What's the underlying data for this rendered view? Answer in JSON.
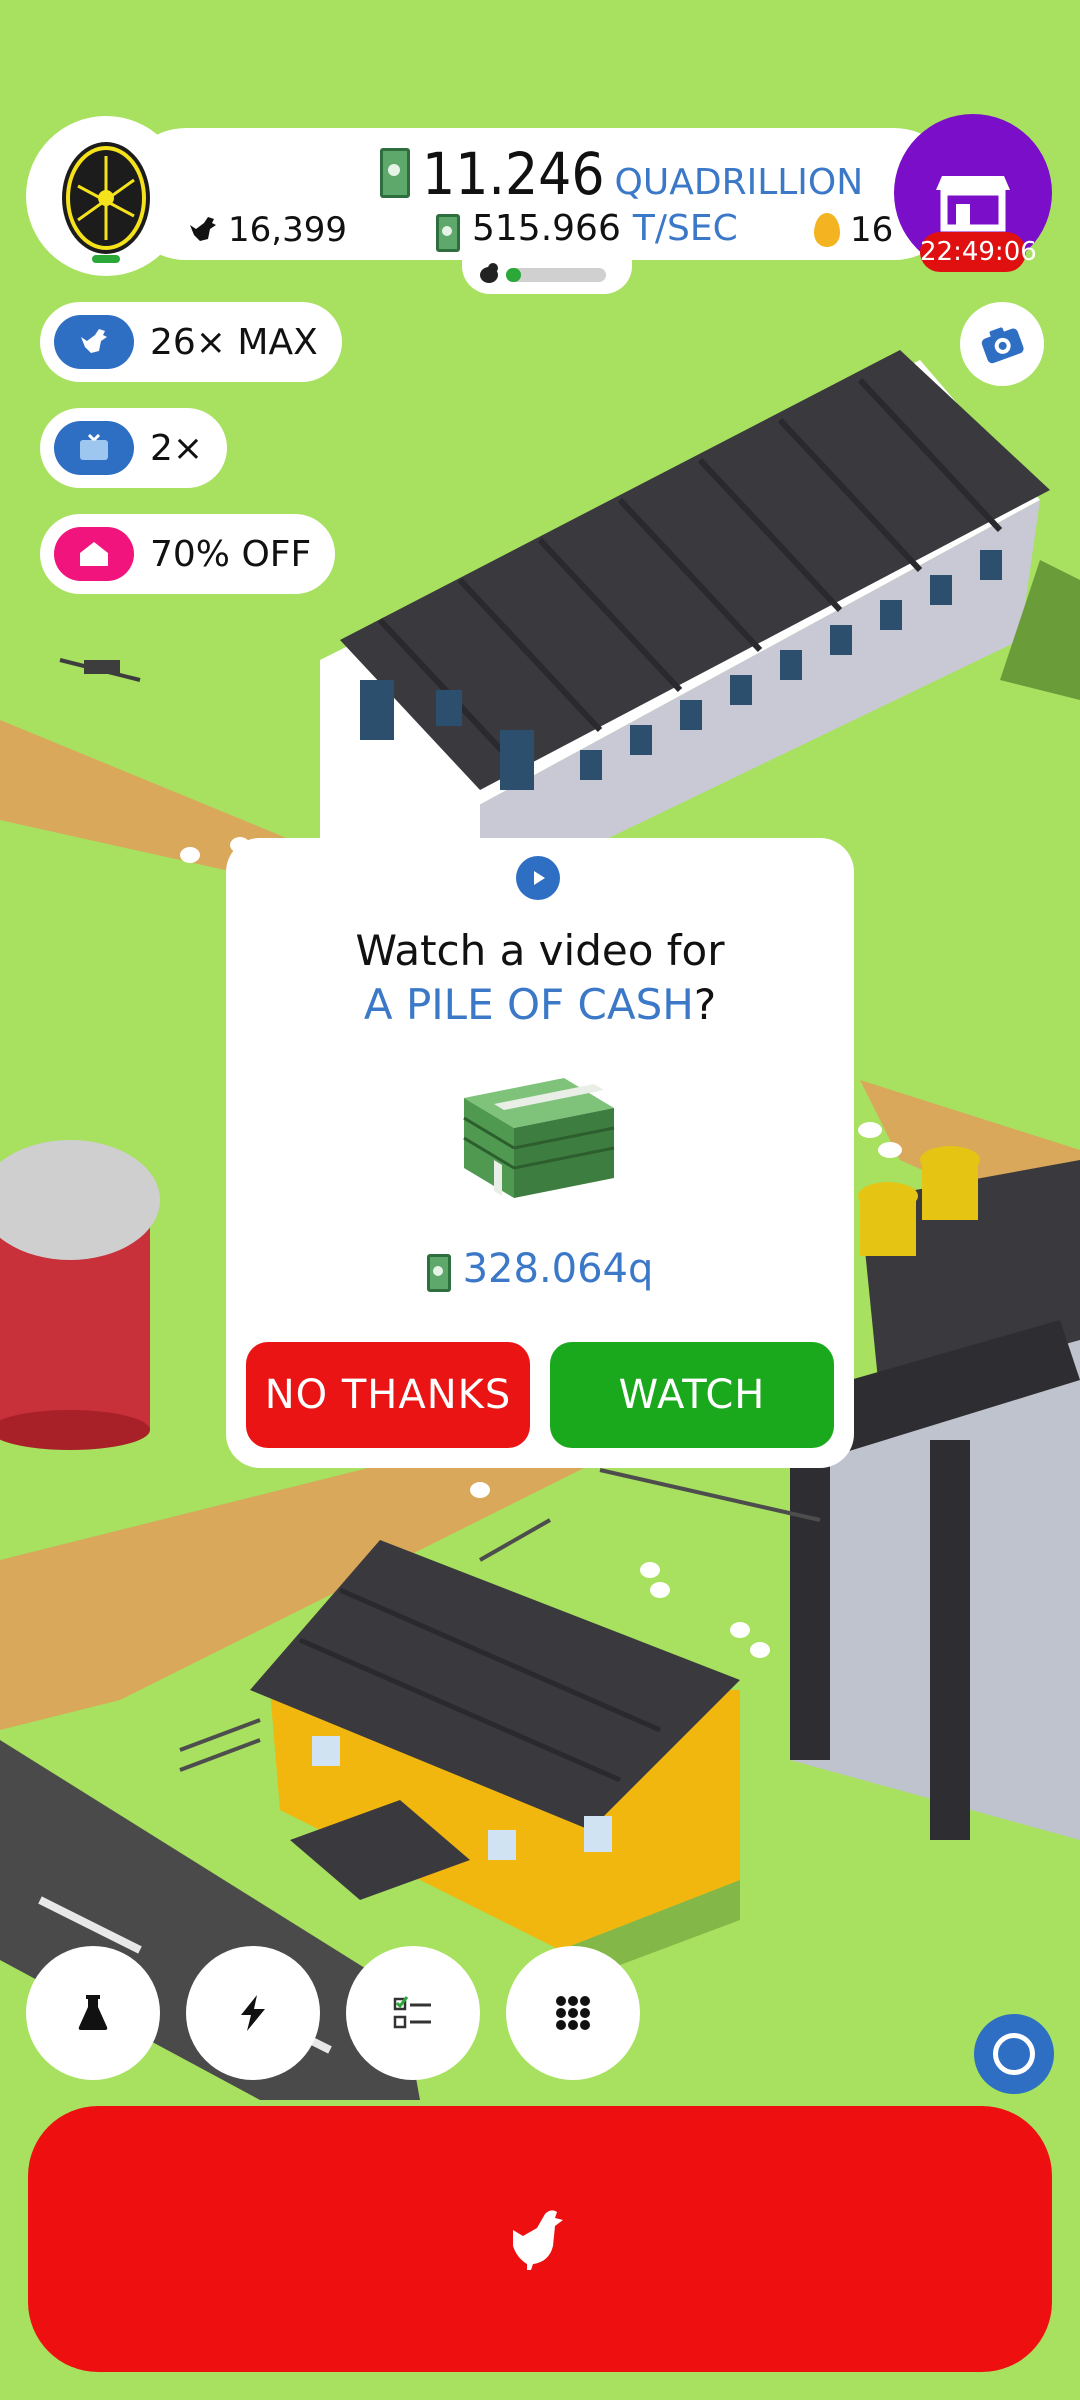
{
  "hud": {
    "money_value": "11.246",
    "money_unit": "QUADRILLION",
    "income_value": "515.966",
    "income_unit": "T/SEC",
    "chicken_count": "16,399",
    "golden_eggs": "16",
    "shop_timer": "22:49:06",
    "hatchery_progress": 0.15
  },
  "boosts": [
    {
      "label": "26× MAX",
      "icon": "chicken-icon",
      "color": "#2e6fc4"
    },
    {
      "label": "2×",
      "icon": "tv-icon",
      "color": "#2e6fc4"
    },
    {
      "label": "70% OFF",
      "icon": "house-icon",
      "color": "#f0147c"
    }
  ],
  "dialog": {
    "title": "Watch a video for",
    "highlight": "A PILE OF CASH",
    "suffix": "?",
    "amount": "328.064q",
    "no_label": "NO THANKS",
    "watch_label": "WATCH"
  },
  "toolbar": [
    "flask-icon",
    "lightning-icon",
    "checklist-icon",
    "grid-icon"
  ],
  "colors": {
    "grass": "#a8e060",
    "accent_blue": "#3b78c8",
    "hatch_red": "#ee1010",
    "watch_green": "#1aa81c",
    "shop_purple": "#7b0fc9"
  }
}
